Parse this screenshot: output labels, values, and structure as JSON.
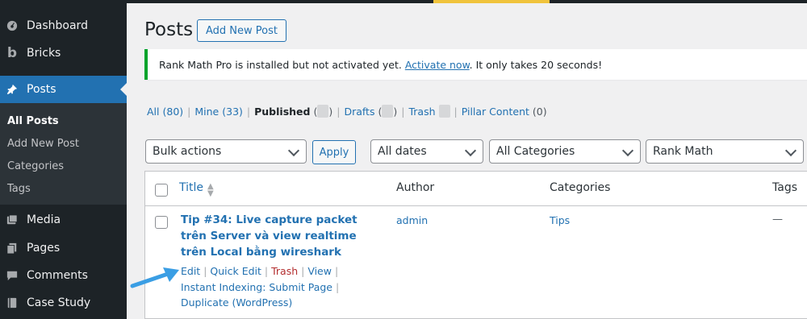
{
  "sidebar": {
    "items": [
      {
        "label": "Dashboard",
        "icon": "dashboard-icon"
      },
      {
        "label": "Bricks",
        "icon": "bricks-icon"
      },
      {
        "label": "Posts",
        "icon": "pushpin-icon"
      },
      {
        "label": "Media",
        "icon": "media-icon"
      },
      {
        "label": "Pages",
        "icon": "pages-icon"
      },
      {
        "label": "Comments",
        "icon": "comments-icon"
      },
      {
        "label": "Case Study",
        "icon": "book-icon"
      }
    ],
    "submenu": [
      "All Posts",
      "Add New Post",
      "Categories",
      "Tags"
    ]
  },
  "header": {
    "title": "Posts",
    "add_new": "Add New Post"
  },
  "notice": {
    "text_before": "Rank Math Pro is installed but not activated yet.",
    "link": "Activate now",
    "text_after": ". It only takes 20 seconds!"
  },
  "filters": {
    "all": "All",
    "all_count": "(80)",
    "mine": "Mine",
    "mine_count": "(33)",
    "published": "Published",
    "drafts": "Drafts",
    "trash": "Trash",
    "pillar": "Pillar Content",
    "pillar_count": "(0)"
  },
  "toolbar": {
    "bulk_actions": "Bulk actions",
    "apply": "Apply",
    "dates": "All dates",
    "categories": "All Categories",
    "rankmath": "Rank Math"
  },
  "table": {
    "columns": [
      "Title",
      "Author",
      "Categories",
      "Tags"
    ],
    "row": {
      "title": "Tip #34: Live capture packet trên Server và view realtime trên Local bằng wireshark",
      "actions": {
        "edit": "Edit",
        "quick_edit": "Quick Edit",
        "trash": "Trash",
        "view": "View",
        "instant": "Instant Indexing: Submit Page",
        "duplicate": "Duplicate (WordPress)"
      },
      "author": "admin",
      "category": "Tips",
      "tags": "—"
    }
  },
  "colors": {
    "link": "#2271b1",
    "sidebar_bg": "#1d2327",
    "active": "#2271b1",
    "notice_border": "#00a32a",
    "arrow": "#3a9ee4"
  }
}
